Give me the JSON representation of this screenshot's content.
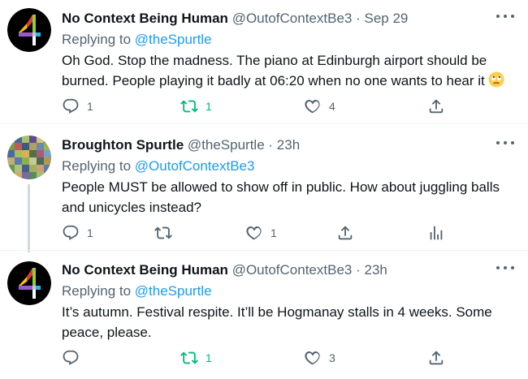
{
  "tweets": [
    {
      "name": "No Context Being Human",
      "handle": "@OutofContextBe3",
      "separator": "·",
      "time": "Sep 29",
      "replying_prefix": "Replying to ",
      "replying_to": "@theSpurtle",
      "text": "Oh God. Stop the madness. The piano at Edinburgh airport should be burned. People playing it badly at 06:20 when no one wants to hear it",
      "emoji": "face-with-rolling-eyes",
      "replies": "1",
      "retweets": "1",
      "likes": "4",
      "avatar_icon": "channel-4-logo"
    },
    {
      "name": "Broughton Spurtle",
      "handle": "@theSpurtle",
      "separator": "·",
      "time": "23h",
      "replying_prefix": "Replying to ",
      "replying_to": "@OutofContextBe3",
      "text": "People MUST be allowed to show off in public. How about juggling balls and unicycles instead?",
      "replies": "1",
      "retweets": "",
      "likes": "1",
      "avatar_icon": "mosaic-avatar"
    },
    {
      "name": "No Context Being Human",
      "handle": "@OutofContextBe3",
      "separator": "·",
      "time": "23h",
      "replying_prefix": "Replying to ",
      "replying_to": "@theSpurtle",
      "text": "It’s autumn. Festival respite. It’ll be Hogmanay stalls in 4 weeks. Some peace, please.",
      "replies": "",
      "retweets": "1",
      "likes": "3",
      "avatar_icon": "channel-4-logo"
    }
  ],
  "colors": {
    "text": "#0f1419",
    "secondary": "#536471",
    "link": "#1d9bf0",
    "retweet_active": "#00ba7c",
    "divider": "#eff3f4"
  }
}
